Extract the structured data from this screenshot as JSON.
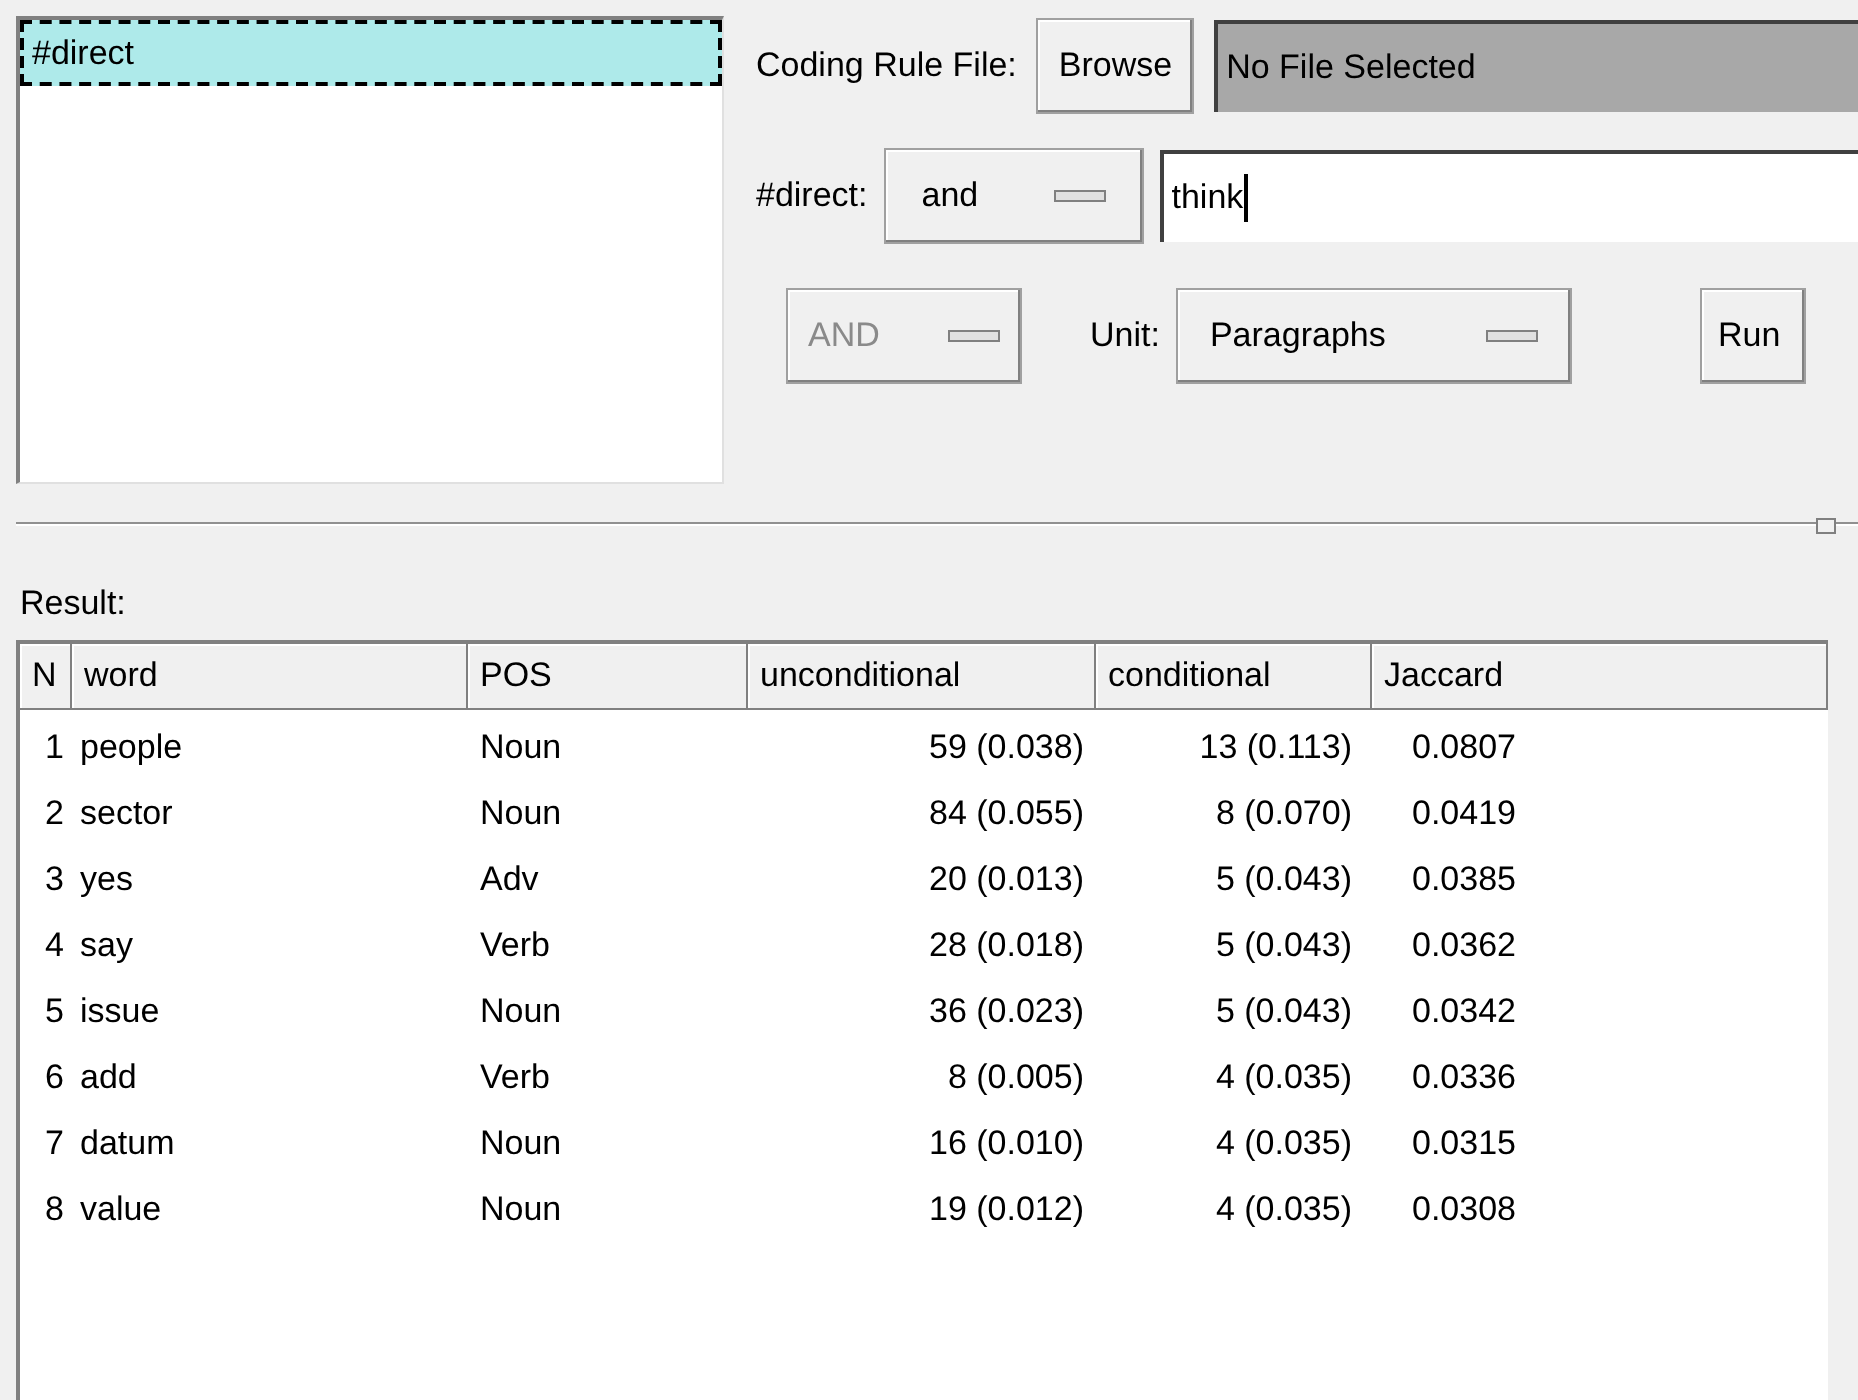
{
  "codes_list": {
    "items": [
      {
        "label": "#direct",
        "selected": true
      }
    ]
  },
  "coding_rule_file": {
    "label": "Coding Rule File:",
    "browse_button": "Browse",
    "file_field": "No File Selected"
  },
  "code_row": {
    "label": "#direct:",
    "operator": "and",
    "search_field": "think"
  },
  "options_row": {
    "combine": {
      "label": "AND",
      "disabled": true
    },
    "unit_label": "Unit:",
    "unit": "Paragraphs",
    "run_button": "Run"
  },
  "result_label": "Result:",
  "table": {
    "columns": [
      "N",
      "word",
      "POS",
      "unconditional",
      "conditional",
      "Jaccard"
    ],
    "rows": [
      [
        "1",
        "people",
        "Noun",
        "59 (0.038)",
        "13 (0.113)",
        "0.0807"
      ],
      [
        "2",
        "sector",
        "Noun",
        "84 (0.055)",
        "8 (0.070)",
        "0.0419"
      ],
      [
        "3",
        "yes",
        "Adv",
        "20 (0.013)",
        "5 (0.043)",
        "0.0385"
      ],
      [
        "4",
        "say",
        "Verb",
        "28 (0.018)",
        "5 (0.043)",
        "0.0362"
      ],
      [
        "5",
        "issue",
        "Noun",
        "36 (0.023)",
        "5 (0.043)",
        "0.0342"
      ],
      [
        "6",
        "add",
        "Verb",
        "8 (0.005)",
        "4 (0.035)",
        "0.0336"
      ],
      [
        "7",
        "datum",
        "Noun",
        "16 (0.010)",
        "4 (0.035)",
        "0.0315"
      ],
      [
        "8",
        "value",
        "Noun",
        "19 (0.012)",
        "4 (0.035)",
        "0.0308"
      ]
    ]
  }
}
